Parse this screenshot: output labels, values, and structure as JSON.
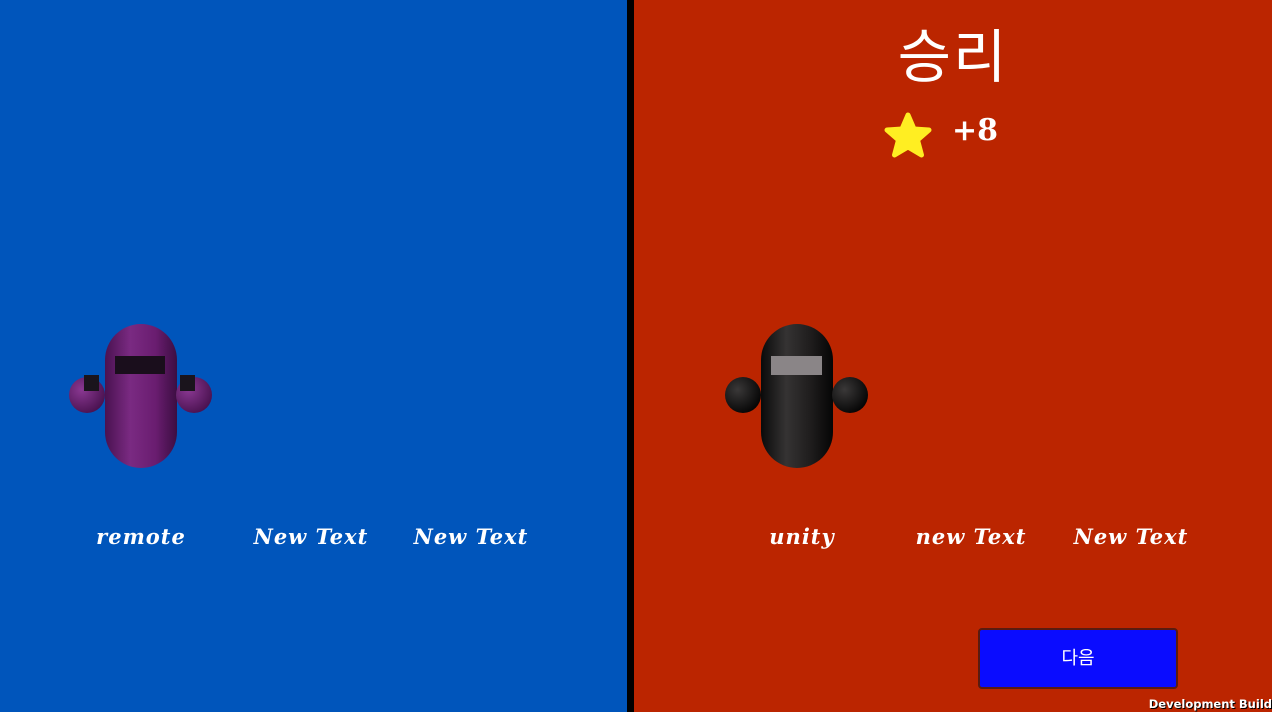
{
  "colors": {
    "left_bg": "#0055bb",
    "divider": "#000000",
    "right_bg": "#bb2500",
    "star": "#ffee22",
    "next_button_bg": "#0a0cff",
    "player_left_body": "#6a1d70",
    "player_right_body": "#222222"
  },
  "right_panel": {
    "title": "승리",
    "reward_icon": "star-icon",
    "reward_value": "+8"
  },
  "left_team": {
    "players": [
      {
        "name": "remote"
      },
      {
        "name": "New Text"
      },
      {
        "name": "New Text"
      }
    ]
  },
  "right_team": {
    "players": [
      {
        "name": "unity"
      },
      {
        "name": "new Text"
      },
      {
        "name": "New Text"
      }
    ]
  },
  "next_button_label": "다음",
  "watermark": "Development Build"
}
